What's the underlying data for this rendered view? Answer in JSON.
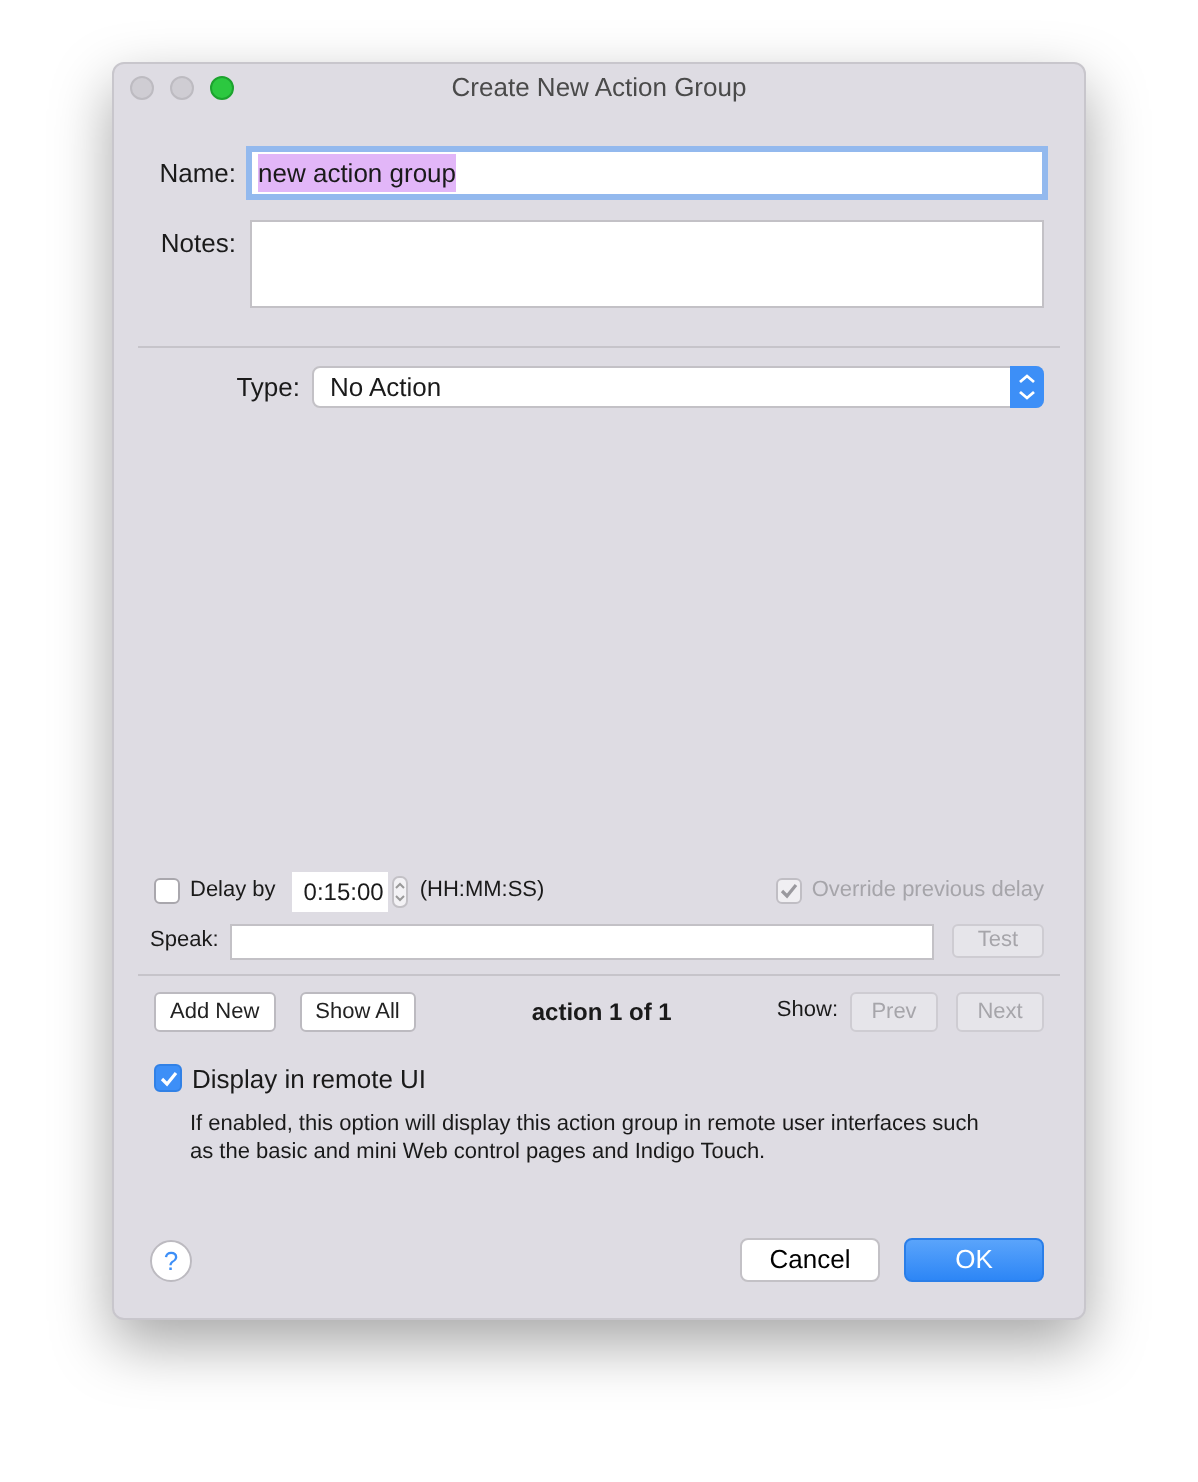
{
  "window": {
    "title": "Create New Action Group"
  },
  "name_field": {
    "label": "Name:",
    "value": "new action group",
    "focused": true,
    "text_selected": true
  },
  "notes_field": {
    "label": "Notes:"
  },
  "type_select": {
    "label": "Type:",
    "value": "No Action"
  },
  "delay": {
    "label": "Delay by",
    "checked": false,
    "value": "0:15:00",
    "format_hint": "(HH:MM:SS)"
  },
  "override": {
    "label": "Override previous delay",
    "checked": true,
    "disabled": true
  },
  "speak": {
    "label": "Speak:",
    "button": {
      "label": "Test",
      "disabled": true
    }
  },
  "action_nav": {
    "buttons": [
      {
        "label": "Add New",
        "disabled": false
      },
      {
        "label": "Show All",
        "disabled": false
      }
    ],
    "counter": "action 1 of 1",
    "show_label": "Show:",
    "nav_buttons": [
      {
        "label": "Prev",
        "disabled": true
      },
      {
        "label": "Next",
        "disabled": true
      }
    ]
  },
  "remote_ui": {
    "label": "Display in remote UI",
    "checked": true,
    "description": "If enabled, this option will display this action group in remote user interfaces such as the basic and mini Web control pages and Indigo Touch."
  },
  "help_button": "?",
  "footer_buttons": [
    {
      "label": "Cancel",
      "default": false
    },
    {
      "label": "OK",
      "default": true
    }
  ]
}
